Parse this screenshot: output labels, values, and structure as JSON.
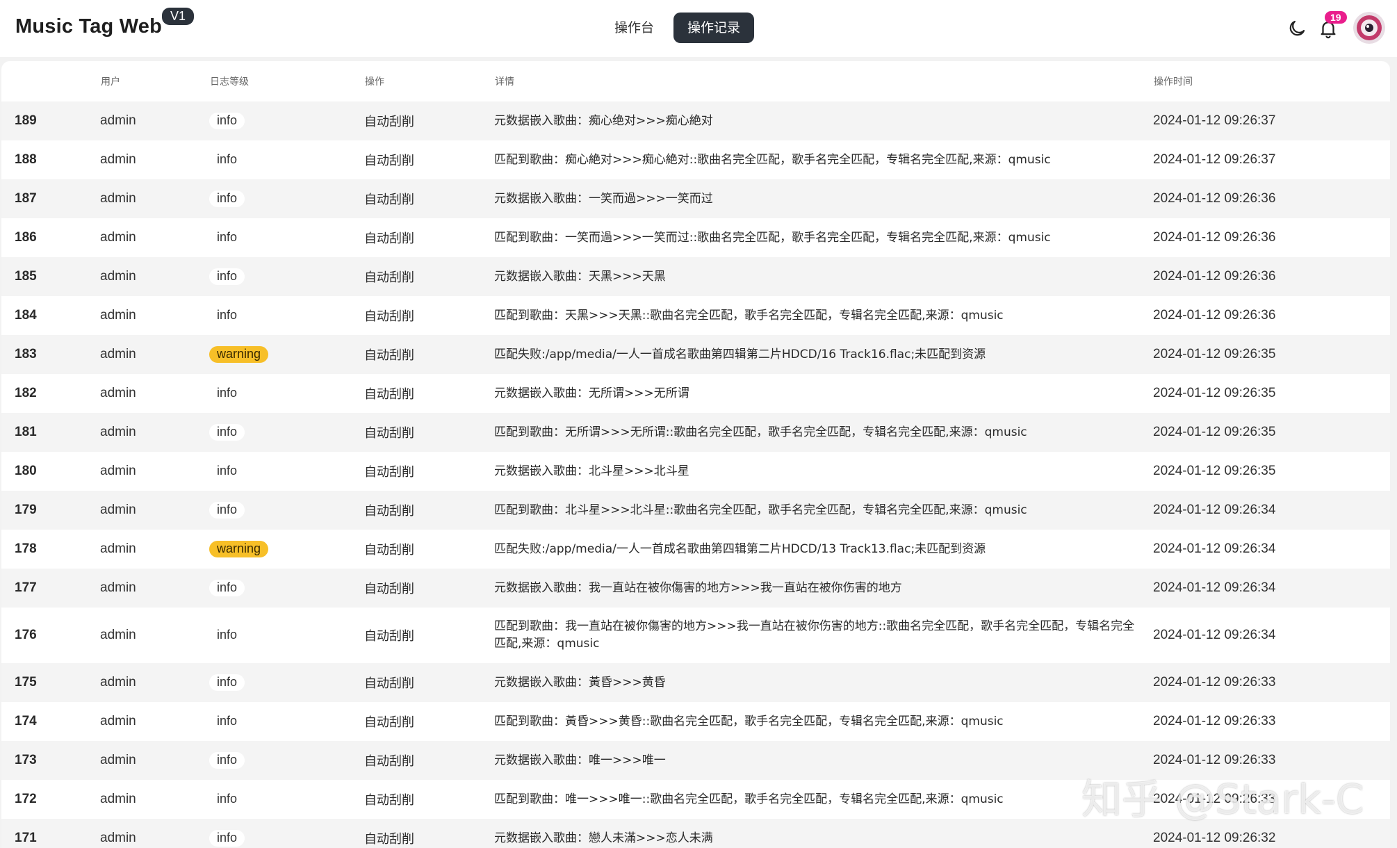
{
  "app": {
    "title": "Music Tag Web",
    "version": "V1"
  },
  "nav": {
    "tabs": [
      "操作台",
      "操作记录"
    ],
    "active": 1
  },
  "notifications": {
    "count": "19"
  },
  "icons": {
    "theme": "moon-icon",
    "notifications": "bell-icon"
  },
  "colors": {
    "warning": "#f7bf28",
    "active_nav": "#2b323b",
    "badge": "#e91e8c"
  },
  "table": {
    "headers": [
      "",
      "用户",
      "日志等级",
      "操作",
      "详情",
      "操作时间"
    ],
    "rows": [
      {
        "id": "189",
        "user": "admin",
        "level": "info",
        "action": "自动刮削",
        "detail": "元数据嵌入歌曲：痴心绝对>>>痴心絶对",
        "time": "2024-01-12 09:26:37"
      },
      {
        "id": "188",
        "user": "admin",
        "level": "info",
        "action": "自动刮削",
        "detail": "匹配到歌曲：痴心絶对>>>痴心絶对::歌曲名完全匹配，歌手名完全匹配，专辑名完全匹配,来源：qmusic",
        "time": "2024-01-12 09:26:37"
      },
      {
        "id": "187",
        "user": "admin",
        "level": "info",
        "action": "自动刮削",
        "detail": "元数据嵌入歌曲：一笑而過>>>一笑而过",
        "time": "2024-01-12 09:26:36"
      },
      {
        "id": "186",
        "user": "admin",
        "level": "info",
        "action": "自动刮削",
        "detail": "匹配到歌曲：一笑而過>>>一笑而过::歌曲名完全匹配，歌手名完全匹配，专辑名完全匹配,来源：qmusic",
        "time": "2024-01-12 09:26:36"
      },
      {
        "id": "185",
        "user": "admin",
        "level": "info",
        "action": "自动刮削",
        "detail": "元数据嵌入歌曲：天黑>>>天黑",
        "time": "2024-01-12 09:26:36"
      },
      {
        "id": "184",
        "user": "admin",
        "level": "info",
        "action": "自动刮削",
        "detail": "匹配到歌曲：天黑>>>天黑::歌曲名完全匹配，歌手名完全匹配，专辑名完全匹配,来源：qmusic",
        "time": "2024-01-12 09:26:36"
      },
      {
        "id": "183",
        "user": "admin",
        "level": "warning",
        "action": "自动刮削",
        "detail": "匹配失败:/app/media/一人一首成名歌曲第四辑第二片HDCD/16 Track16.flac;未匹配到资源",
        "time": "2024-01-12 09:26:35"
      },
      {
        "id": "182",
        "user": "admin",
        "level": "info",
        "action": "自动刮削",
        "detail": "元数据嵌入歌曲：无所谓>>>无所谓",
        "time": "2024-01-12 09:26:35"
      },
      {
        "id": "181",
        "user": "admin",
        "level": "info",
        "action": "自动刮削",
        "detail": "匹配到歌曲：无所谓>>>无所谓::歌曲名完全匹配，歌手名完全匹配，专辑名完全匹配,来源：qmusic",
        "time": "2024-01-12 09:26:35"
      },
      {
        "id": "180",
        "user": "admin",
        "level": "info",
        "action": "自动刮削",
        "detail": "元数据嵌入歌曲：北斗星>>>北斗星",
        "time": "2024-01-12 09:26:35"
      },
      {
        "id": "179",
        "user": "admin",
        "level": "info",
        "action": "自动刮削",
        "detail": "匹配到歌曲：北斗星>>>北斗星::歌曲名完全匹配，歌手名完全匹配，专辑名完全匹配,来源：qmusic",
        "time": "2024-01-12 09:26:34"
      },
      {
        "id": "178",
        "user": "admin",
        "level": "warning",
        "action": "自动刮削",
        "detail": "匹配失败:/app/media/一人一首成名歌曲第四辑第二片HDCD/13 Track13.flac;未匹配到资源",
        "time": "2024-01-12 09:26:34"
      },
      {
        "id": "177",
        "user": "admin",
        "level": "info",
        "action": "自动刮削",
        "detail": "元数据嵌入歌曲：我一直站在被你傷害的地方>>>我一直站在被你伤害的地方",
        "time": "2024-01-12 09:26:34"
      },
      {
        "id": "176",
        "user": "admin",
        "level": "info",
        "action": "自动刮削",
        "detail": "匹配到歌曲：我一直站在被你傷害的地方>>>我一直站在被你伤害的地方::歌曲名完全匹配，歌手名完全匹配，专辑名完全匹配,来源：qmusic",
        "time": "2024-01-12 09:26:34"
      },
      {
        "id": "175",
        "user": "admin",
        "level": "info",
        "action": "自动刮削",
        "detail": "元数据嵌入歌曲：黃昏>>>黄昏",
        "time": "2024-01-12 09:26:33"
      },
      {
        "id": "174",
        "user": "admin",
        "level": "info",
        "action": "自动刮削",
        "detail": "匹配到歌曲：黃昏>>>黄昏::歌曲名完全匹配，歌手名完全匹配，专辑名完全匹配,来源：qmusic",
        "time": "2024-01-12 09:26:33"
      },
      {
        "id": "173",
        "user": "admin",
        "level": "info",
        "action": "自动刮削",
        "detail": "元数据嵌入歌曲：唯一>>>唯一",
        "time": "2024-01-12 09:26:33"
      },
      {
        "id": "172",
        "user": "admin",
        "level": "info",
        "action": "自动刮削",
        "detail": "匹配到歌曲：唯一>>>唯一::歌曲名完全匹配，歌手名完全匹配，专辑名完全匹配,来源：qmusic",
        "time": "2024-01-12 09:26:33"
      },
      {
        "id": "171",
        "user": "admin",
        "level": "info",
        "action": "自动刮削",
        "detail": "元数据嵌入歌曲：戀人未滿>>>恋人未满",
        "time": "2024-01-12 09:26:32"
      }
    ]
  },
  "watermark": "知乎 @Stark-C"
}
